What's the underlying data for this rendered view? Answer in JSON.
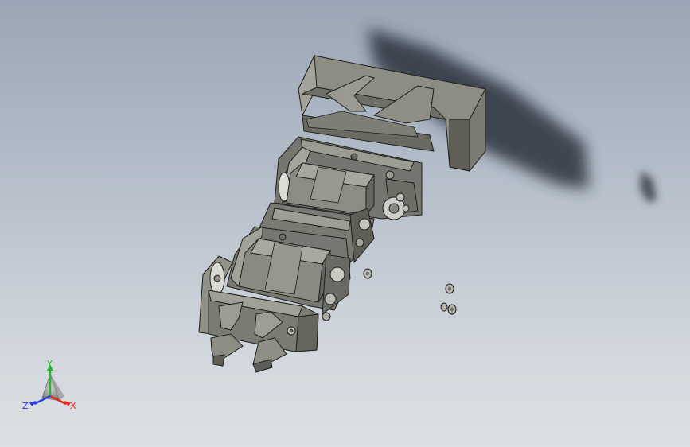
{
  "view_triad": {
    "x_label": "X",
    "y_label": "Y",
    "z_label": "Z",
    "x_color": "#e8261d",
    "y_color": "#27b52b",
    "z_color": "#2b3de0"
  },
  "colors": {
    "background_top": "#9aa6b5",
    "background_bottom": "#dcdfe3",
    "part_face_light": "#8f8f86",
    "part_face_mid": "#727269",
    "part_face_dark": "#56564f",
    "shadow": "#2e3540"
  }
}
